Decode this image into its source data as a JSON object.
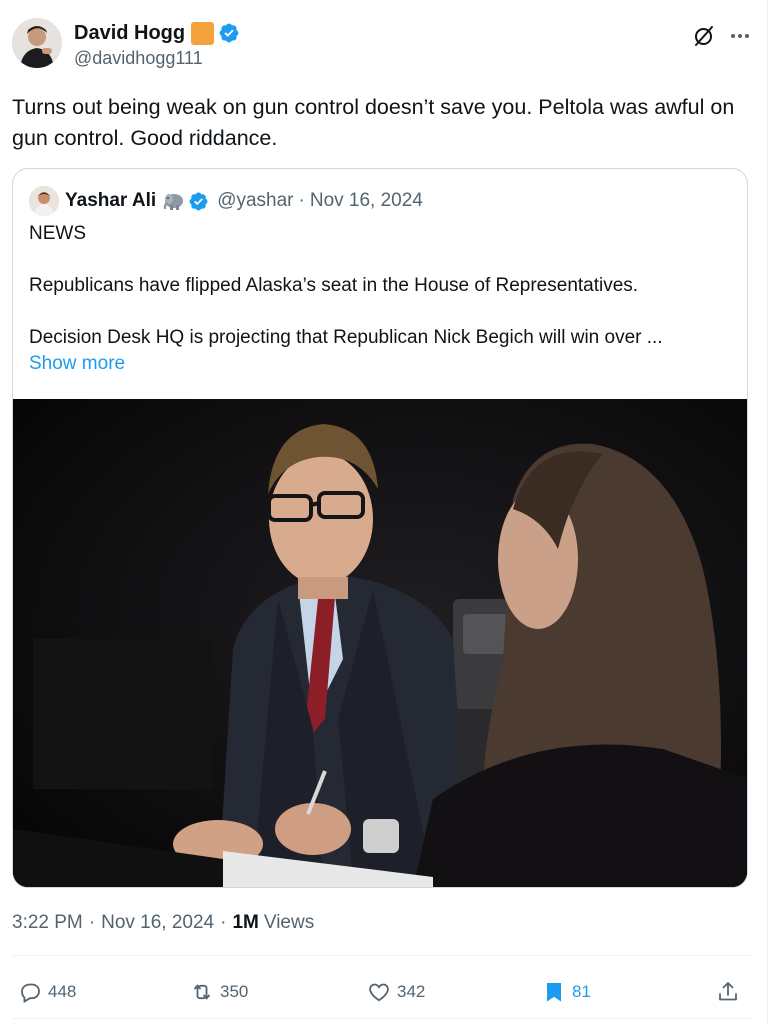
{
  "author": {
    "display_name": "David Hogg",
    "handle": "@davidhogg111"
  },
  "tweet": {
    "text": "Turns out being weak on gun control doesn’t save you. Peltola was awful on gun control. Good riddance."
  },
  "quote": {
    "display_name": "Yashar Ali",
    "handle": "@yashar",
    "separator": "·",
    "date": "Nov 16, 2024",
    "line1": "NEWS",
    "line2": "Republicans have flipped Alaska’s seat in the House of Representatives.",
    "line3": "Decision Desk HQ is projecting that Republican Nick Begich will win over ...",
    "show_more": "Show more"
  },
  "meta": {
    "time": "3:22 PM",
    "separator": "·",
    "date": "Nov 16, 2024",
    "views_count": "1M",
    "views_label": "Views"
  },
  "actions": {
    "replies": "448",
    "reposts": "350",
    "likes": "342",
    "bookmarks": "81"
  },
  "icons": [
    "verified-badge-icon",
    "grok-icon",
    "more-icon",
    "elephant-emoji-icon",
    "reply-icon",
    "repost-icon",
    "like-icon",
    "bookmark-icon",
    "share-icon"
  ],
  "colors": {
    "accent": "#1d9bf0",
    "secondary_text": "#536471",
    "border": "#cfd9de",
    "flag_badge": "#f4a23c"
  }
}
